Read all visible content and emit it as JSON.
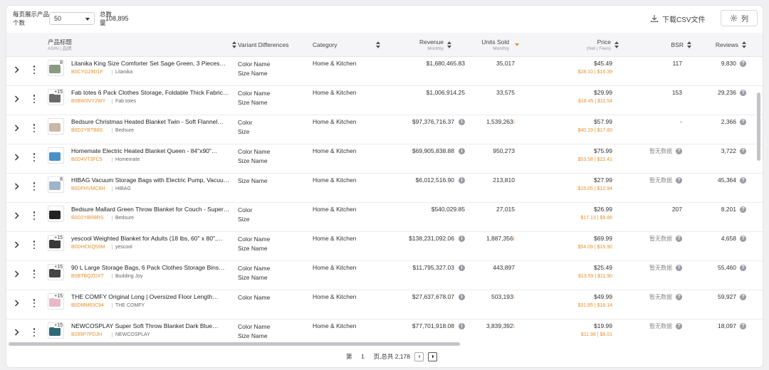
{
  "toolbar": {
    "per_page_label": "每页展示产品个数",
    "per_page_value": "50",
    "total_label": "总数量",
    "total_value": "108,895",
    "csv_label": "下载CSV文件",
    "columns_label": "列"
  },
  "columns": {
    "product_title": "产品标题",
    "product_sub": "ASIN | 品牌",
    "variant": "Variant Differences",
    "category": "Category",
    "revenue": "Revenue",
    "revenue_sub": "Monthly",
    "units": "Units Sold",
    "units_sub": "Monthly",
    "price": "Price",
    "price_sub": "(Net | Fees)",
    "bsr": "BSR",
    "reviews": "Reviews"
  },
  "rows": [
    {
      "badge": "8",
      "img_color": "#8a9a80",
      "title": "Litanika King Size Comforter Set Sage Green, 3 Pieces…",
      "asin": "B0CYG29D1F",
      "brand": "Litanika",
      "variant1": "Color Name",
      "variant2": "Size Name",
      "category": "Home & Kitchen",
      "revenue": "$1,680,465.83",
      "revenue_info": false,
      "units": "35,017",
      "units_flag": false,
      "price": "$45.49",
      "fees": "$28.10 | $16.39",
      "bsr": "117",
      "reviews": "9,830"
    },
    {
      "badge": "+15",
      "img_color": "#6b6b6b",
      "title": "Fab totes 6 Pack Clothes Storage, Foldable Thick Fabric…",
      "asin": "B0BW3VY2WY",
      "brand": "Fab totes",
      "variant1": "Color Name",
      "variant2": "Size Name",
      "category": "Home & Kitchen",
      "revenue": "$1,006,914.25",
      "revenue_info": false,
      "units": "33,575",
      "units_flag": false,
      "price": "$29.99",
      "fees": "$18.45 | $11.54",
      "bsr": "153",
      "reviews": "29,236"
    },
    {
      "badge": "",
      "img_color": "#c9b8a8",
      "title": "Bedsure Christmas Heated Blanket Twin - Soft Flannel…",
      "asin": "B0D2YBTB8S",
      "brand": "Bedsure",
      "variant1": "Color",
      "variant2": "Size",
      "category": "Home & Kitchen",
      "revenue": "$97,376,716.37",
      "revenue_info": true,
      "units": "1,539,263",
      "units_flag": true,
      "price": "$57.99",
      "fees": "$40.19 | $17.80",
      "bsr": "-",
      "reviews": "2,366"
    },
    {
      "badge": "",
      "img_color": "#4a90c8",
      "title": "Homemate Electric Heated Blanket Queen - 84\"x90\"…",
      "asin": "B0D4VT3FC5",
      "brand": "Homemate",
      "variant1": "Color Name",
      "variant2": "Size Name",
      "category": "Home & Kitchen",
      "revenue": "$69,905,838.88",
      "revenue_info": true,
      "units": "950,273",
      "units_flag": false,
      "price": "$75.99",
      "fees": "$53.58 | $22.41",
      "bsr": "暂无数据",
      "reviews": "3,722"
    },
    {
      "badge": "8",
      "img_color": "#9fb4c8",
      "title": "HIBAG Vacuum Storage Bags with Electric Pump, Vacuu…",
      "asin": "B0DFHVMC6H",
      "brand": "HIBAG",
      "variant1": "Size Name",
      "variant2": "",
      "category": "Home & Kitchen",
      "revenue": "$6,012,516.90",
      "revenue_info": true,
      "units": "213,810",
      "units_flag": false,
      "price": "$27.99",
      "fees": "$15.05 | $12.94",
      "bsr": "暂无数据",
      "reviews": "45,364"
    },
    {
      "badge": "",
      "img_color": "#222222",
      "title": "Bedsure Mallard Green Throw Blanket for Couch - Super…",
      "asin": "B0D2YBR8RS",
      "brand": "Bedsure",
      "variant1": "Color",
      "variant2": "Size",
      "category": "Home & Kitchen",
      "revenue": "$540,029.85",
      "revenue_info": false,
      "units": "27,015",
      "units_flag": false,
      "price": "$26.99",
      "fees": "$17.13 | $9.86",
      "bsr": "207",
      "reviews": "8,201"
    },
    {
      "badge": "+15",
      "img_color": "#3a3a3a",
      "title": "yescool Weighted Blanket for Adults (18 lbs, 60\" x 80\",…",
      "asin": "B0DHCKQ59M",
      "brand": "yescool",
      "variant1": "Color Name",
      "variant2": "Size Name",
      "category": "Home & Kitchen",
      "revenue": "$138,231,092.06",
      "revenue_info": true,
      "units": "1,887,356",
      "units_flag": true,
      "price": "$69.99",
      "fees": "$54.09 | $15.90",
      "bsr": "暂无数据",
      "reviews": "4,658"
    },
    {
      "badge": "+15",
      "img_color": "#444444",
      "title": "90 L Large Storage Bags, 6 Pack Clothes Storage Bins…",
      "asin": "B0BTBQZDXT",
      "brand": "Budding Joy",
      "variant1": "Color Name",
      "variant2": "Size Name",
      "category": "Home & Kitchen",
      "revenue": "$11,795,327.03",
      "revenue_info": true,
      "units": "443,897",
      "units_flag": false,
      "price": "$25.49",
      "fees": "$13.59 | $11.90",
      "bsr": "暂无数据",
      "reviews": "55,460"
    },
    {
      "badge": "+15",
      "img_color": "#e6b8c8",
      "title": "THE COMFY Original Long | Oversized Floor Length…",
      "asin": "B0DMM63C94",
      "brand": "THE COMFY",
      "variant1": "Color Name",
      "variant2": "",
      "category": "Home & Kitchen",
      "revenue": "$27,637,678.07",
      "revenue_info": true,
      "units": "503,193",
      "units_flag": true,
      "price": "$49.99",
      "fees": "$31.85 | $18.14",
      "bsr": "暂无数据",
      "reviews": "59,927"
    },
    {
      "badge": "+15",
      "img_color": "#2f6a78",
      "title": "NEWCOSPLAY Super Soft Throw Blanket Dark Blue…",
      "asin": "B099P7PDJH",
      "brand": "NEWCOSPLAY",
      "variant1": "Color Name",
      "variant2": "Size Name",
      "category": "Home & Kitchen",
      "revenue": "$77,701,918.08",
      "revenue_info": true,
      "units": "3,839,392",
      "units_flag": true,
      "price": "$19.99",
      "fees": "$11.98 | $8.01",
      "bsr": "暂无数据",
      "reviews": "18,097"
    }
  ],
  "pagination": {
    "page_prefix": "第",
    "current_page": "1",
    "page_suffix": "页,总共 2,178"
  },
  "colors": {
    "accent": "#e8902b"
  }
}
